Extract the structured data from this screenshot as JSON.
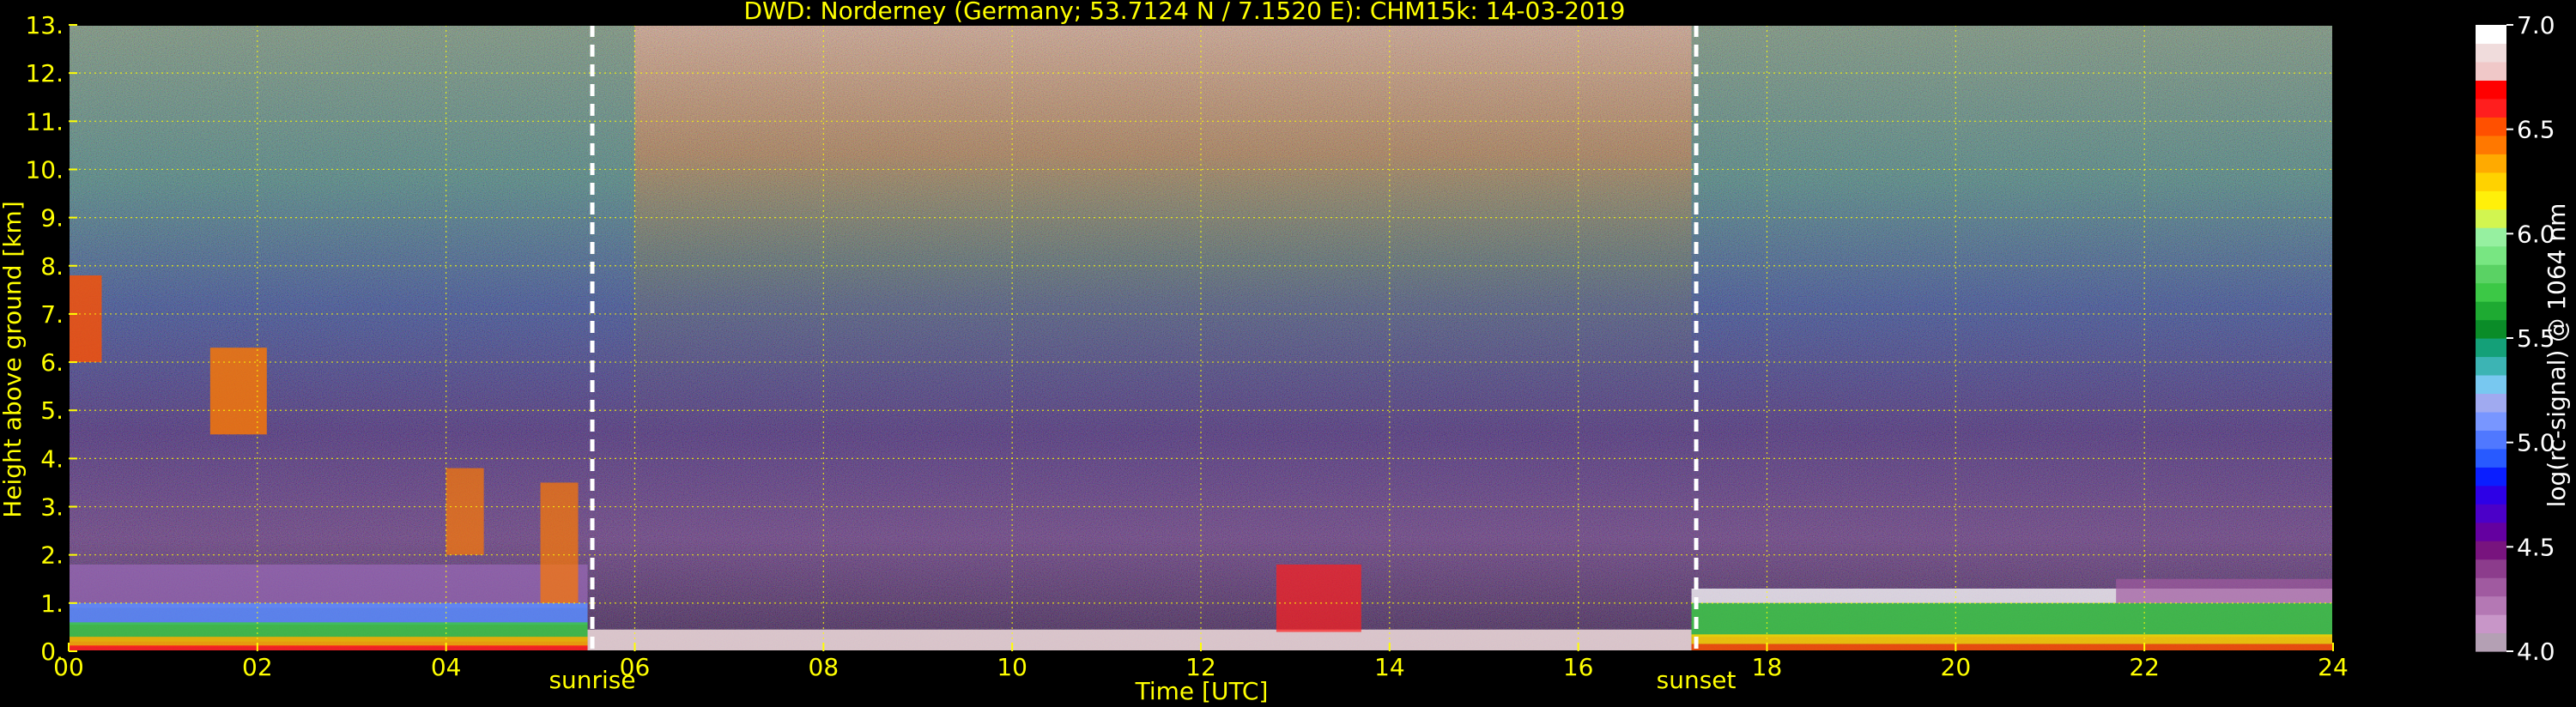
{
  "chart_data": {
    "type": "heatmap",
    "title": "DWD: Norderney (Germany; 53.7124 N / 7.1520 E):    CHM15k: 14-03-2019",
    "xlabel": "Time [UTC]",
    "ylabel": "Height above ground [km]",
    "colorbar_label": "log(rc-signal) @ 1064 nm",
    "xlim": [
      0,
      24
    ],
    "ylim": [
      0,
      13
    ],
    "x_ticks": [
      0,
      2,
      4,
      6,
      8,
      10,
      12,
      14,
      16,
      18,
      20,
      22,
      24
    ],
    "x_tick_labels": [
      "00",
      "02",
      "04",
      "06",
      "08",
      "10",
      "12",
      "14",
      "16",
      "18",
      "20",
      "22",
      "24"
    ],
    "y_ticks": [
      0,
      1,
      2,
      3,
      4,
      5,
      6,
      7,
      8,
      9,
      10,
      11,
      12,
      13
    ],
    "y_tick_labels": [
      "0.",
      "1.",
      "2.",
      "3.",
      "4.",
      "5.",
      "6.",
      "7.",
      "8.",
      "9.",
      "10.",
      "11.",
      "12.",
      "13."
    ],
    "colorbar_range": [
      4.0,
      7.0
    ],
    "colorbar_ticks": [
      4.0,
      4.5,
      5.0,
      5.5,
      6.0,
      6.5,
      7.0
    ],
    "colorbar_tick_labels": [
      "4.0",
      "4.5",
      "5.0",
      "5.5",
      "6.0",
      "6.5",
      "7.0"
    ],
    "colorbar_colors": [
      "#b4a0b4",
      "#c896c8",
      "#b478b4",
      "#a05aa0",
      "#8c3c8c",
      "#78147e",
      "#6400a0",
      "#4b00c8",
      "#2d00e6",
      "#0a1eff",
      "#285aff",
      "#5078ff",
      "#7896ff",
      "#a0aaf0",
      "#78c8f0",
      "#3cb4b4",
      "#14a078",
      "#0a8c28",
      "#1eaa32",
      "#3cc846",
      "#5ad264",
      "#78e682",
      "#96f0a0",
      "#d2f550",
      "#fff00a",
      "#ffd200",
      "#ffaa00",
      "#ff7800",
      "#ff5000",
      "#ff1e1e",
      "#ff0000",
      "#f0c8c8",
      "#f0dcdc",
      "#ffffff"
    ],
    "annotations": [
      {
        "label": "sunrise",
        "x": 5.55
      },
      {
        "label": "sunset",
        "x": 17.25
      }
    ],
    "grid": true,
    "grid_color": "#ffff00",
    "label_color": "#ffff00"
  }
}
